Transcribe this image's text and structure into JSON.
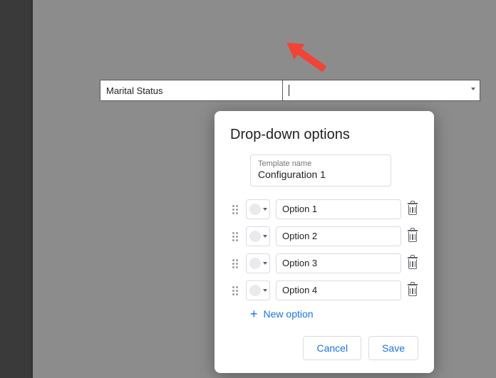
{
  "table": {
    "label": "Marital Status"
  },
  "dialog": {
    "title": "Drop-down options",
    "template_label": "Template name",
    "template_value": "Configuration 1",
    "options": [
      {
        "label": "Option 1"
      },
      {
        "label": "Option 2"
      },
      {
        "label": "Option 3"
      },
      {
        "label": "Option 4"
      }
    ],
    "new_option_label": "New option",
    "cancel_label": "Cancel",
    "save_label": "Save"
  }
}
